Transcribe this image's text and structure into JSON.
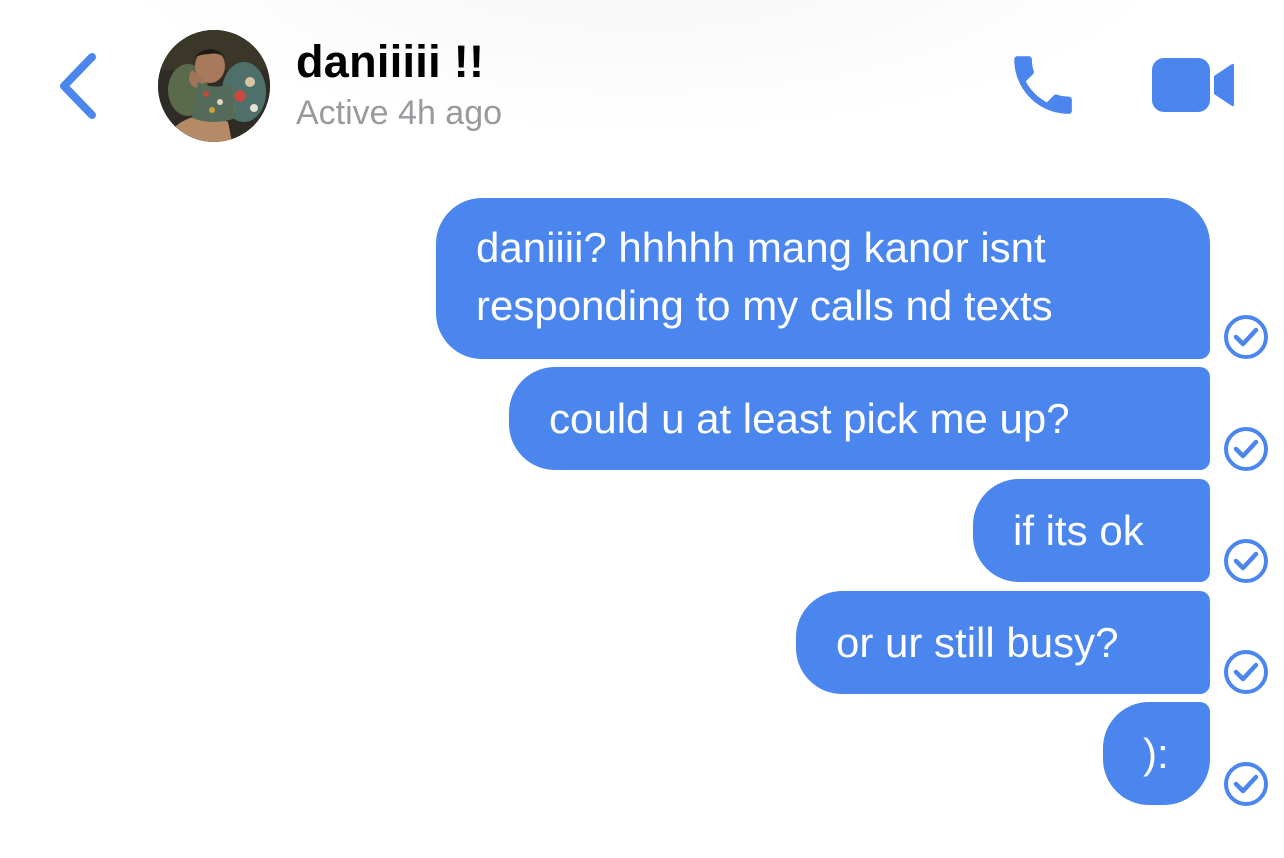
{
  "header": {
    "back_icon": "chevron-left-icon",
    "contact_name": "daniiiii !!",
    "status": "Active 4h ago",
    "call_icon": "phone-icon",
    "video_icon": "video-camera-icon"
  },
  "messages": [
    {
      "lines": [
        "daniiii? hhhhh mang kanor isnt",
        "responding to my calls nd texts"
      ],
      "receipt": "read-receipt-icon"
    },
    {
      "lines": [
        "could u at least pick me up?"
      ],
      "receipt": "read-receipt-icon"
    },
    {
      "lines": [
        "if its ok"
      ],
      "receipt": "read-receipt-icon"
    },
    {
      "lines": [
        "or ur still busy?"
      ],
      "receipt": "read-receipt-icon"
    },
    {
      "lines": [
        "):"
      ],
      "receipt": "read-receipt-icon"
    }
  ],
  "colors": {
    "accent": "#4b85ee",
    "bubble_text": "#ffffff",
    "status_text": "#9a9a9e",
    "background": "#ffffff"
  }
}
